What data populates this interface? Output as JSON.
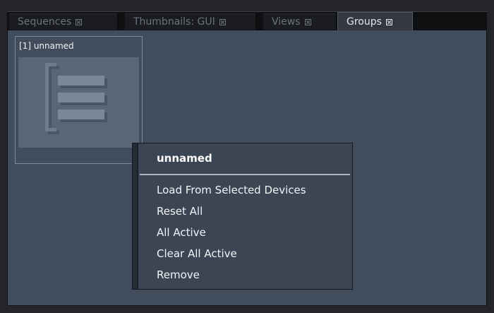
{
  "tabs": [
    {
      "label": "Sequences",
      "active": false
    },
    {
      "label": "Thumbnails: GUI",
      "active": false
    },
    {
      "label": "Views",
      "active": false
    },
    {
      "label": "Groups",
      "active": true
    }
  ],
  "tile": {
    "title": "[1] unnamed",
    "icon": "group-list-icon"
  },
  "context_menu": {
    "title": "unnamed",
    "items": [
      {
        "label": "Load From Selected Devices"
      },
      {
        "label": "Reset All"
      },
      {
        "label": "All Active"
      },
      {
        "label": "Clear All Active"
      },
      {
        "label": "Remove"
      }
    ]
  },
  "colors": {
    "panel_bg": "#414c5c",
    "menu_bg": "#3b4554",
    "active_tab_bg": "#333840",
    "tab_strip_bg": "#0e0f11"
  }
}
